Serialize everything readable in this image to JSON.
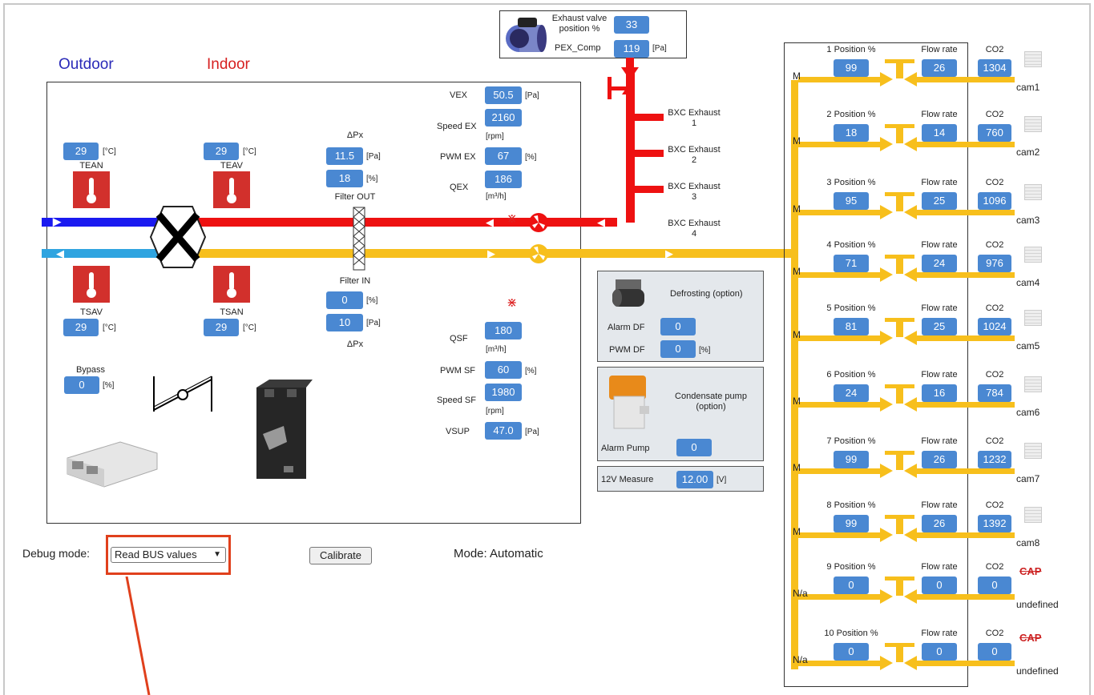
{
  "header": {
    "outdoor": "Outdoor",
    "indoor": "Indoor"
  },
  "exhaust_valve": {
    "label1": "Exhaust valve",
    "label2": "position %",
    "position": "33",
    "pex_label": "PEX_Comp",
    "pex_value": "119",
    "pex_unit": "[Pa]"
  },
  "sensors": {
    "tean": {
      "label": "TEAN",
      "value": "29",
      "unit": "[°C]"
    },
    "teav": {
      "label": "TEAV",
      "value": "29",
      "unit": "[°C]"
    },
    "tsav": {
      "label": "TSAV",
      "value": "29",
      "unit": "[°C]"
    },
    "tsan": {
      "label": "TSAN",
      "value": "29",
      "unit": "[°C]"
    }
  },
  "filter_out": {
    "dpx_label": "ΔPx",
    "pa_value": "11.5",
    "pa_unit": "[Pa]",
    "pct_value": "18",
    "pct_unit": "[%]",
    "label": "Filter OUT"
  },
  "filter_in": {
    "label": "Filter IN",
    "pct_value": "0",
    "pct_unit": "[%]",
    "pa_value": "10",
    "pa_unit": "[Pa]",
    "dpx_label": "ΔPx"
  },
  "exhaust_fan": {
    "vex_label": "VEX",
    "vex_value": "50.5",
    "vex_unit": "[Pa]",
    "speed_label": "Speed EX",
    "speed_value": "2160",
    "speed_unit": "[rpm]",
    "pwm_label": "PWM EX",
    "pwm_value": "67",
    "pwm_unit": "[%]",
    "q_label": "QEX",
    "q_value": "186",
    "q_unit": "[m³/h]"
  },
  "supply_fan": {
    "q_label": "QSF",
    "q_value": "180",
    "q_unit": "[m³/h]",
    "pwm_label": "PWM SF",
    "pwm_value": "60",
    "pwm_unit": "[%]",
    "speed_label": "Speed SF",
    "speed_value": "1980",
    "speed_unit": "[rpm]",
    "vsup_label": "VSUP",
    "vsup_value": "47.0",
    "vsup_unit": "[Pa]"
  },
  "bypass": {
    "label": "Bypass",
    "value": "0",
    "unit": "[%]"
  },
  "bxc": [
    {
      "l1": "BXC Exhaust",
      "l2": "1"
    },
    {
      "l1": "BXC Exhaust",
      "l2": "2"
    },
    {
      "l1": "BXC Exhaust",
      "l2": "3"
    },
    {
      "l1": "BXC Exhaust",
      "l2": "4"
    }
  ],
  "defrost": {
    "title": "Defrosting (option)",
    "alarm_label": "Alarm DF",
    "alarm_value": "0",
    "pwm_label": "PWM DF",
    "pwm_value": "0",
    "pwm_unit": "[%]"
  },
  "condensate": {
    "title1": "Condensate pump",
    "title2": "(option)",
    "alarm_label": "Alarm Pump",
    "alarm_value": "0"
  },
  "measure12v": {
    "label": "12V Measure",
    "value": "12.00",
    "unit": "[V]"
  },
  "zones": [
    {
      "pos_label": "1 Position %",
      "pos": "99",
      "flow_label": "Flow rate",
      "flow": "26",
      "co2_label": "CO2",
      "co2": "1304",
      "cam": "cam1",
      "mode": "M"
    },
    {
      "pos_label": "2 Position %",
      "pos": "18",
      "flow_label": "Flow rate",
      "flow": "14",
      "co2_label": "CO2",
      "co2": "760",
      "cam": "cam2",
      "mode": "M"
    },
    {
      "pos_label": "3 Position %",
      "pos": "95",
      "flow_label": "Flow rate",
      "flow": "25",
      "co2_label": "CO2",
      "co2": "1096",
      "cam": "cam3",
      "mode": "M"
    },
    {
      "pos_label": "4 Position %",
      "pos": "71",
      "flow_label": "Flow rate",
      "flow": "24",
      "co2_label": "CO2",
      "co2": "976",
      "cam": "cam4",
      "mode": "M"
    },
    {
      "pos_label": "5 Position %",
      "pos": "81",
      "flow_label": "Flow rate",
      "flow": "25",
      "co2_label": "CO2",
      "co2": "1024",
      "cam": "cam5",
      "mode": "M"
    },
    {
      "pos_label": "6 Position %",
      "pos": "24",
      "flow_label": "Flow rate",
      "flow": "16",
      "co2_label": "CO2",
      "co2": "784",
      "cam": "cam6",
      "mode": "M"
    },
    {
      "pos_label": "7 Position %",
      "pos": "99",
      "flow_label": "Flow rate",
      "flow": "26",
      "co2_label": "CO2",
      "co2": "1232",
      "cam": "cam7",
      "mode": "M"
    },
    {
      "pos_label": "8 Position %",
      "pos": "99",
      "flow_label": "Flow rate",
      "flow": "26",
      "co2_label": "CO2",
      "co2": "1392",
      "cam": "cam8",
      "mode": "M"
    },
    {
      "pos_label": "9 Position %",
      "pos": "0",
      "flow_label": "Flow rate",
      "flow": "0",
      "co2_label": "CO2",
      "co2": "0",
      "cam": "undefined",
      "mode": "N/a",
      "cap": "CAP"
    },
    {
      "pos_label": "10 Position %",
      "pos": "0",
      "flow_label": "Flow rate",
      "flow": "0",
      "co2_label": "CO2",
      "co2": "0",
      "cam": "undefined",
      "mode": "N/a",
      "cap": "CAP"
    }
  ],
  "controls": {
    "debug_label": "Debug mode:",
    "debug_value": "Read BUS values",
    "calibrate_label": "Calibrate",
    "mode_text": "Mode: Automatic"
  },
  "colors": {
    "supply": "#f7bf1c",
    "exhaust": "#ee1111",
    "outdoor": "#1a1af0",
    "indoor": "#d62020",
    "value_box": "#4a88d2",
    "highlight": "#e0401c"
  }
}
